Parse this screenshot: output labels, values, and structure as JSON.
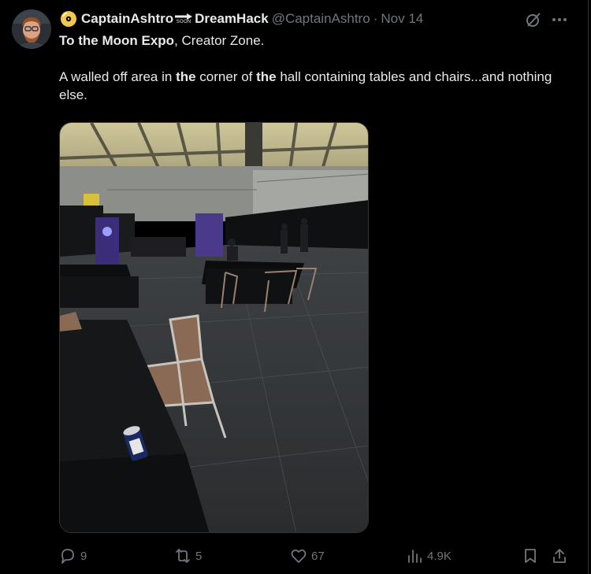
{
  "tweet": {
    "author": {
      "display_name_part1": "CaptainAshtro",
      "display_name_part2": "DreamHack",
      "arrow_emoji_text": "SOON",
      "handle": "@CaptainAshtro",
      "separator": "·",
      "date": "Nov 14"
    },
    "text": {
      "line1_bold": "To the Moon Expo",
      "line1_rest": ", Creator Zone.",
      "p2_seg1": "A walled off area in ",
      "p2_bold1": "the",
      "p2_seg2": " corner of ",
      "p2_bold2": "the",
      "p2_seg3": " hall containing tables and chairs...and nothing else."
    },
    "media_alt": "Photo of a mostly empty walled-off area of an expo hall with black-clothed tables and folding chairs",
    "actions": {
      "replies": "9",
      "reposts": "5",
      "likes": "67",
      "views": "4.9K"
    },
    "icons": [
      "grok-icon",
      "more-icon",
      "reply-icon",
      "repost-icon",
      "like-icon",
      "views-icon",
      "bookmark-icon",
      "share-icon"
    ],
    "colors": {
      "background": "#000000",
      "text": "#e7e9ea",
      "muted": "#71767b",
      "divider": "#2f3336"
    }
  }
}
